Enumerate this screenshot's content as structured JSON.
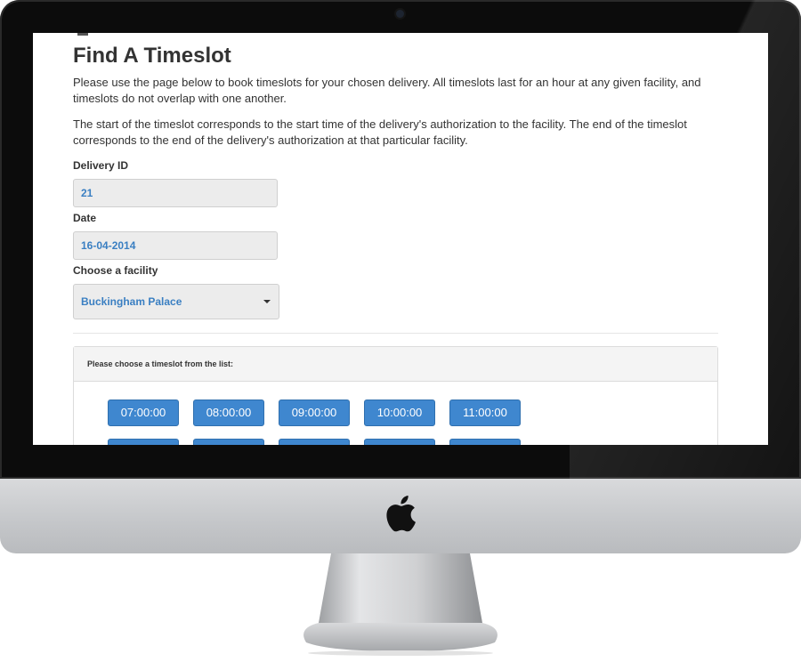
{
  "page": {
    "title": "Find A Timeslot",
    "intro_1": "Please use the page below to book timeslots for your chosen delivery. All timeslots last for an hour at any given facility, and timeslots do not overlap with one another.",
    "intro_2": "The start of the timeslot corresponds to the start time of the delivery's authorization to the facility. The end of the timeslot corresponds to the end of the delivery's authorization at that particular facility."
  },
  "form": {
    "delivery_id_label": "Delivery ID",
    "delivery_id_value": "21",
    "date_label": "Date",
    "date_value": "16-04-2014",
    "facility_label": "Choose a facility",
    "facility_value": "Buckingham Palace"
  },
  "timeslots": {
    "heading": "Please choose a timeslot from the list:",
    "row1": [
      "07:00:00",
      "08:00:00",
      "09:00:00",
      "10:00:00",
      "11:00:00"
    ],
    "row2": [
      "",
      "",
      "",
      "",
      ""
    ]
  },
  "colors": {
    "accent": "#3f87cf",
    "field_text": "#3a7fc2",
    "bezel": "#0c0c0c"
  }
}
